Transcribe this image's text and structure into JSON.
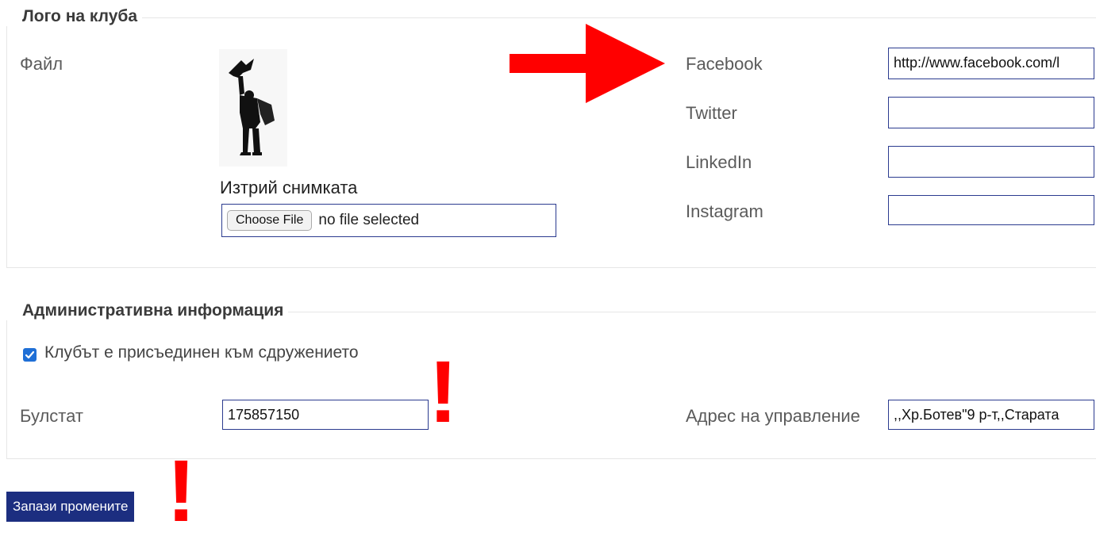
{
  "logo_section": {
    "legend": "Лого на клуба",
    "file_label": "Файл",
    "delete_link": "Изтрий снимката",
    "choose_file_label": "Choose File",
    "file_status": "no file selected",
    "logo_icon": "club-logo-figure"
  },
  "social": {
    "facebook_label": "Facebook",
    "facebook_value": "http://www.facebook.com/l",
    "twitter_label": "Twitter",
    "twitter_value": "",
    "linkedin_label": "LinkedIn",
    "linkedin_value": "",
    "instagram_label": "Instagram",
    "instagram_value": ""
  },
  "admin_section": {
    "legend": "Административна информация",
    "member_checkbox_label": "Клубът е присъединен към сдружението",
    "member_checked": true,
    "bulstat_label": "Булстат",
    "bulstat_value": "175857150",
    "address_label": "Адрес на управление",
    "address_value": ",,Хр.Ботев\"9 р-т,,Старата"
  },
  "save_button_label": "Запази промените",
  "annotations": {
    "arrow_color": "#ff0000",
    "exclamation_glyph": "!"
  },
  "colors": {
    "input_border": "#2b3b8f",
    "save_button_bg": "#1c2e80",
    "checkbox": "#1f6fd6"
  }
}
